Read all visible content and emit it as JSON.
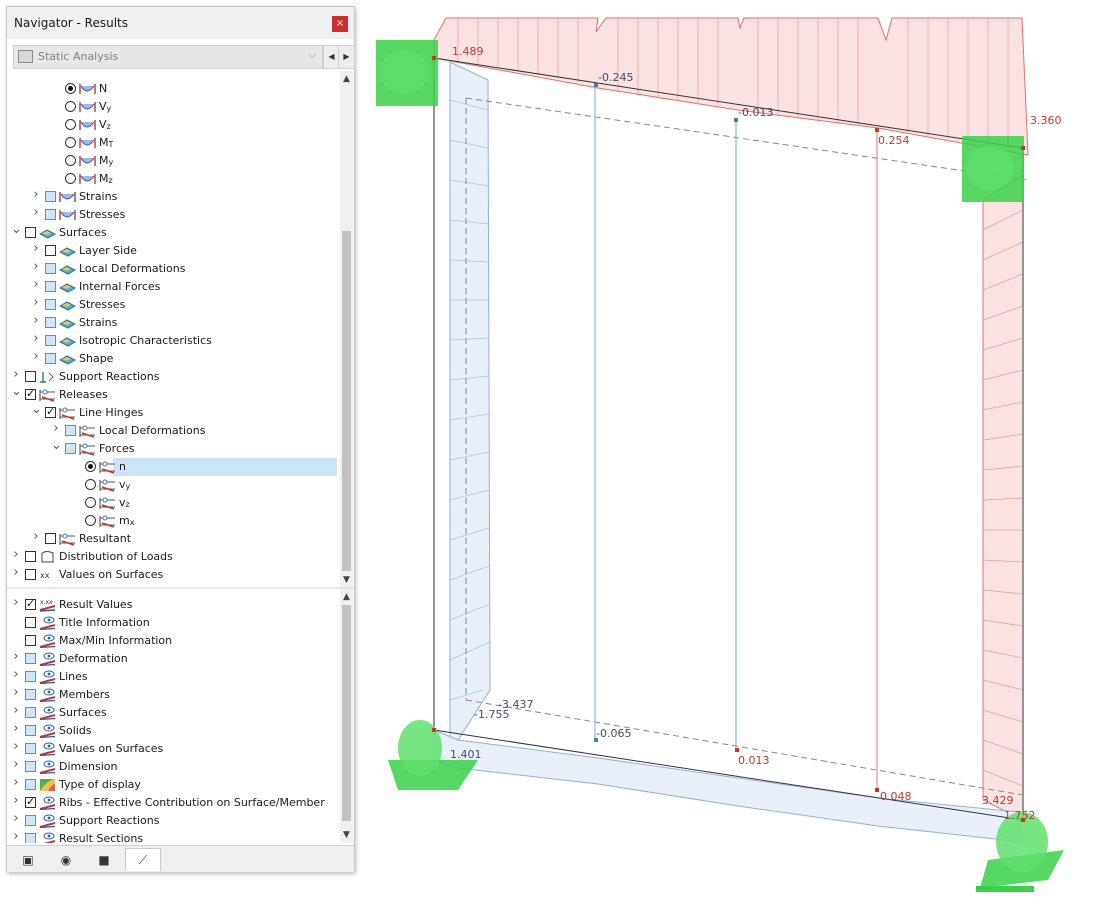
{
  "window": {
    "title": "Navigator - Results",
    "close_glyph": "×"
  },
  "combo": {
    "value": "Static Analysis",
    "prev_glyph": "◀",
    "next_glyph": "▶"
  },
  "tree": [
    {
      "label": "N",
      "sub": "",
      "kind": "radio",
      "on": true,
      "icon": "member-force-icon",
      "indent": 70
    },
    {
      "label": "V",
      "sub": "y",
      "kind": "radio",
      "on": false,
      "icon": "member-force-icon",
      "indent": 70
    },
    {
      "label": "V",
      "sub": "z",
      "kind": "radio",
      "on": false,
      "icon": "member-force-icon",
      "indent": 70
    },
    {
      "label": "M",
      "sub": "T",
      "kind": "radio",
      "on": false,
      "icon": "member-force-icon",
      "indent": 70
    },
    {
      "label": "M",
      "sub": "y",
      "kind": "radio",
      "on": false,
      "icon": "member-force-icon",
      "indent": 70
    },
    {
      "label": "M",
      "sub": "z",
      "kind": "radio",
      "on": false,
      "icon": "member-force-icon",
      "indent": 70
    },
    {
      "label": "Strains",
      "kind": "checkbox",
      "state": "blue",
      "expander": ">",
      "icon": "member-force-icon",
      "indent": 50
    },
    {
      "label": "Stresses",
      "kind": "checkbox",
      "state": "blue",
      "expander": ">",
      "icon": "member-force-icon",
      "indent": 50
    },
    {
      "label": "Surfaces",
      "kind": "checkbox",
      "state": "empty",
      "expander": "v",
      "icon": "surface-icon",
      "indent": 30
    },
    {
      "label": "Layer Side",
      "kind": "checkbox",
      "state": "empty",
      "expander": ">",
      "icon": "surface-icon",
      "indent": 50
    },
    {
      "label": "Local Deformations",
      "kind": "checkbox",
      "state": "blue",
      "expander": ">",
      "icon": "surface-icon",
      "indent": 50
    },
    {
      "label": "Internal Forces",
      "kind": "checkbox",
      "state": "blue",
      "expander": ">",
      "icon": "surface-icon",
      "indent": 50
    },
    {
      "label": "Stresses",
      "kind": "checkbox",
      "state": "blue",
      "expander": ">",
      "icon": "surface-icon",
      "indent": 50
    },
    {
      "label": "Strains",
      "kind": "checkbox",
      "state": "blue",
      "expander": ">",
      "icon": "surface-icon",
      "indent": 50
    },
    {
      "label": "Isotropic Characteristics",
      "kind": "checkbox",
      "state": "blue",
      "expander": ">",
      "icon": "surface-icon",
      "indent": 50
    },
    {
      "label": "Shape",
      "kind": "checkbox",
      "state": "blue",
      "expander": ">",
      "icon": "surface-icon",
      "indent": 50
    },
    {
      "label": "Support Reactions",
      "kind": "checkbox",
      "state": "empty",
      "expander": ">",
      "icon": "support-reaction-icon",
      "indent": 30
    },
    {
      "label": "Releases",
      "kind": "checkbox",
      "state": "checked",
      "expander": "v",
      "icon": "release-icon",
      "indent": 30
    },
    {
      "label": "Line Hinges",
      "kind": "checkbox",
      "state": "checked",
      "expander": "v",
      "icon": "release-icon",
      "indent": 50
    },
    {
      "label": "Local Deformations",
      "kind": "checkbox",
      "state": "blue",
      "expander": ">",
      "icon": "release-icon",
      "indent": 70
    },
    {
      "label": "Forces",
      "kind": "checkbox",
      "state": "blue",
      "expander": "v",
      "icon": "release-icon",
      "indent": 70
    },
    {
      "label": "n",
      "sub": "",
      "kind": "radio",
      "on": true,
      "icon": "release-icon",
      "indent": 90,
      "selected": true
    },
    {
      "label": "v",
      "sub": "y",
      "kind": "radio",
      "on": false,
      "icon": "release-icon",
      "indent": 90
    },
    {
      "label": "v",
      "sub": "z",
      "kind": "radio",
      "on": false,
      "icon": "release-icon",
      "indent": 90
    },
    {
      "label": "m",
      "sub": "x",
      "kind": "radio",
      "on": false,
      "icon": "release-icon",
      "indent": 90
    },
    {
      "label": "Resultant",
      "kind": "checkbox",
      "state": "empty",
      "expander": ">",
      "icon": "release-icon",
      "indent": 50
    },
    {
      "label": "Distribution of Loads",
      "kind": "checkbox",
      "state": "empty",
      "expander": ">",
      "icon": "load-distribution-icon",
      "indent": 30
    },
    {
      "label": "Values on Surfaces",
      "kind": "checkbox",
      "state": "empty",
      "expander": ">",
      "icon": "values-icon",
      "indent": 30
    }
  ],
  "tree2": [
    {
      "label": "Result Values",
      "kind": "checkbox",
      "state": "checked",
      "expander": ">",
      "icon": "result-values-icon"
    },
    {
      "label": "Title Information",
      "kind": "checkbox",
      "state": "empty",
      "expander": "",
      "icon": "eye-icon"
    },
    {
      "label": "Max/Min Information",
      "kind": "checkbox",
      "state": "empty",
      "expander": "",
      "icon": "eye-icon"
    },
    {
      "label": "Deformation",
      "kind": "checkbox",
      "state": "blue",
      "expander": ">",
      "icon": "eye-icon"
    },
    {
      "label": "Lines",
      "kind": "checkbox",
      "state": "blue",
      "expander": ">",
      "icon": "eye-icon"
    },
    {
      "label": "Members",
      "kind": "checkbox",
      "state": "blue",
      "expander": ">",
      "icon": "eye-icon"
    },
    {
      "label": "Surfaces",
      "kind": "checkbox",
      "state": "blue",
      "expander": ">",
      "icon": "eye-icon"
    },
    {
      "label": "Solids",
      "kind": "checkbox",
      "state": "blue",
      "expander": ">",
      "icon": "eye-icon"
    },
    {
      "label": "Values on Surfaces",
      "kind": "checkbox",
      "state": "blue",
      "expander": ">",
      "icon": "eye-icon"
    },
    {
      "label": "Dimension",
      "kind": "checkbox",
      "state": "blue",
      "expander": ">",
      "icon": "eye-icon"
    },
    {
      "label": "Type of display",
      "kind": "checkbox",
      "state": "blue",
      "expander": ">",
      "icon": "display-type-icon"
    },
    {
      "label": "Ribs - Effective Contribution on Surface/Member",
      "kind": "checkbox",
      "state": "checked",
      "expander": ">",
      "icon": "eye-icon"
    },
    {
      "label": "Support Reactions",
      "kind": "checkbox",
      "state": "blue",
      "expander": ">",
      "icon": "eye-icon"
    },
    {
      "label": "Result Sections",
      "kind": "checkbox",
      "state": "blue",
      "expander": ">",
      "icon": "eye-icon"
    }
  ],
  "tabs": [
    {
      "name": "tab-data",
      "glyph": "▣"
    },
    {
      "name": "tab-display",
      "glyph": "◉"
    },
    {
      "name": "tab-views",
      "glyph": "■"
    },
    {
      "name": "tab-results",
      "glyph": "⟋"
    }
  ],
  "model_labels": {
    "v1": "1.489",
    "v2": "-0.245",
    "v3": "-0.013",
    "v4": "3.360",
    "v5": "0.254",
    "v6": "-3.437",
    "v7": "-1.755",
    "v8": "1.401",
    "v9": "-0.065",
    "v10": "0.013",
    "v11": "0.048",
    "v12": "3.429",
    "v13": "1.752"
  },
  "colors": {
    "positive": "#e05a5a",
    "negative": "#7aa7d6",
    "support": "#2ecc40"
  }
}
